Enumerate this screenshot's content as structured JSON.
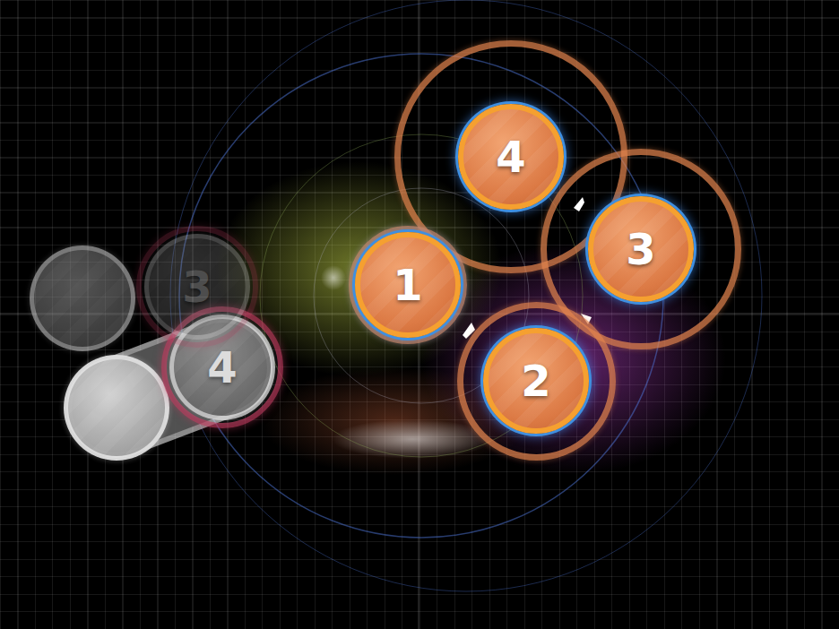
{
  "playfield": {
    "hit_objects": [
      {
        "number": "1",
        "kind": "active",
        "approach": 1.12,
        "fade": 1,
        "ring": false
      },
      {
        "number": "2",
        "kind": "active",
        "approach": 1.5,
        "fade": 1,
        "ring": false
      },
      {
        "number": "3",
        "kind": "active",
        "approach": 1.9,
        "fade": 1,
        "ring": false
      },
      {
        "number": "4",
        "kind": "active",
        "approach": 2.2,
        "fade": 1,
        "ring": false
      },
      {
        "number": "",
        "kind": "passed",
        "approach": 0,
        "fade": 0.55,
        "ring": false
      },
      {
        "number": "3",
        "kind": "passed",
        "approach": 0,
        "fade": 0.3,
        "ring": true
      },
      {
        "number": "4",
        "kind": "passed",
        "approach": 0,
        "fade": 0.8,
        "ring": true
      },
      {
        "number": "",
        "kind": "slider-end",
        "approach": 0,
        "fade": 0.95,
        "ring": false
      }
    ]
  }
}
